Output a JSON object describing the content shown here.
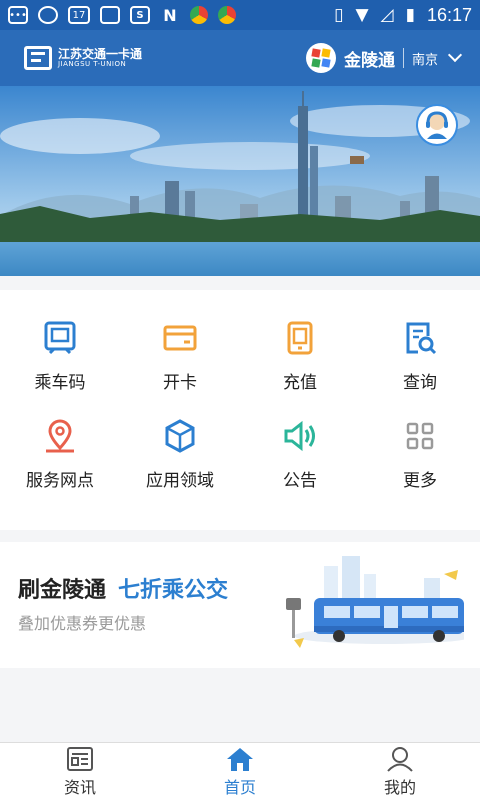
{
  "status_bar": {
    "time": "16:17",
    "notification_badge": "17"
  },
  "header": {
    "logo_cn": "江苏交通一卡通",
    "logo_en": "JIANGSU T-UNION",
    "brand": "金陵通",
    "city": "南京",
    "icons": [
      "logo-icon",
      "brand-logo-icon",
      "chevron-down-icon"
    ]
  },
  "banner": {
    "icons": [
      "customer-service-icon"
    ]
  },
  "menu": {
    "items": [
      {
        "label": "乘车码",
        "icon": "bus-qr-icon"
      },
      {
        "label": "开卡",
        "icon": "card-icon"
      },
      {
        "label": "充值",
        "icon": "topup-icon"
      },
      {
        "label": "查询",
        "icon": "search-document-icon"
      },
      {
        "label": "服务网点",
        "icon": "location-pin-icon"
      },
      {
        "label": "应用领域",
        "icon": "cube-icon"
      },
      {
        "label": "公告",
        "icon": "speaker-icon"
      },
      {
        "label": "更多",
        "icon": "grid-icon"
      }
    ]
  },
  "promo": {
    "title": "刷金陵通",
    "highlight": "七折乘公交",
    "subtitle": "叠加优惠券更优惠"
  },
  "tabbar": {
    "items": [
      {
        "label": "资讯",
        "icon": "news-icon"
      },
      {
        "label": "首页",
        "icon": "home-icon"
      },
      {
        "label": "我的",
        "icon": "user-icon"
      }
    ]
  },
  "colors": {
    "primary": "#2b6cb9",
    "accent_blue": "#2c7fd0",
    "orange": "#f2a23a",
    "red": "#e8604c",
    "green": "#2bb59a",
    "gray_icon": "#9a9a9a"
  }
}
